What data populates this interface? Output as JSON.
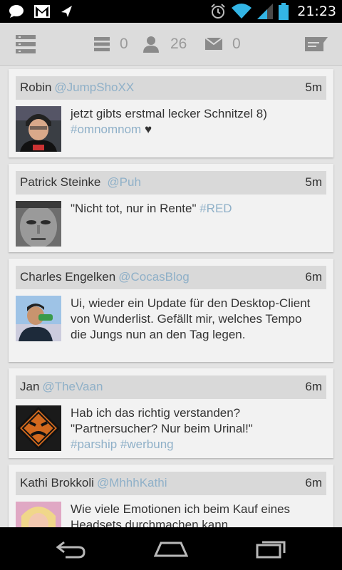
{
  "status_bar": {
    "time": "21:23",
    "icons": [
      "chat-icon",
      "gmail-icon",
      "send-icon",
      "alarm-icon",
      "wifi-icon",
      "signal-icon",
      "battery-icon"
    ]
  },
  "action_bar": {
    "lists_count": "0",
    "followers_count": "26",
    "messages_count": "0"
  },
  "tweets": [
    {
      "name": "Robin",
      "handle": "@JumpShoXX",
      "time": "5m",
      "text": "jetzt gibts erstmal lecker Schnitzel 8)",
      "hashtags": "#omnomnom",
      "extra": "♥"
    },
    {
      "name": "Patrick Steinke",
      "handle": "@Puh",
      "time": "5m",
      "text": "\"Nicht tot, nur in Rente\"",
      "hashtags": "#RED"
    },
    {
      "name": "Charles Engelken",
      "handle": "@CocasBlog",
      "time": "6m",
      "text": "Ui, wieder ein Update für den Desktop-Client von Wunderlist. Gefällt mir, welches Tempo die Jungs nun an den Tag legen."
    },
    {
      "name": "Jan",
      "handle": "@TheVaan",
      "time": "6m",
      "text": "Hab ich das richtig verstanden? \"Partnersucher? Nur beim Urinal!\"",
      "hashtags": "#parship #werbung"
    },
    {
      "name": "Kathi Brokkoli",
      "handle": "@MhhhKathi",
      "time": "6m",
      "text": "Wie viele Emotionen ich beim Kauf eines Headsets durchmachen kann."
    }
  ],
  "colors": {
    "accent": "#8fb0c8",
    "card_bg": "#f2f2f2",
    "header_bg": "#d9d9d9",
    "actionbar_bg": "#dcdcdc",
    "status_accent": "#33b5e5"
  }
}
